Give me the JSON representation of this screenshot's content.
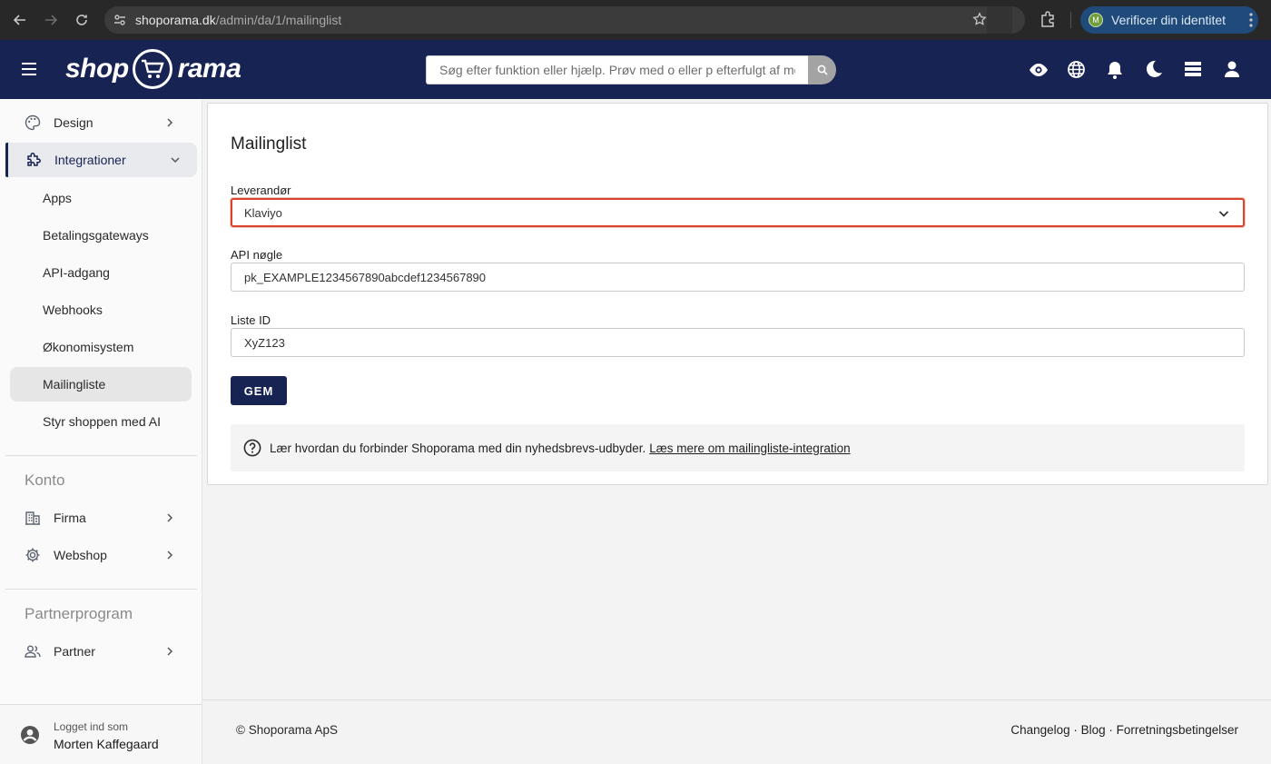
{
  "browser": {
    "url_host": "shoporama.dk",
    "url_path": "/admin/da/1/mailinglist",
    "profile_initial": "M",
    "profile_label": "Verificer din identitet"
  },
  "header": {
    "logo_left": "shop",
    "logo_right": "rama",
    "search_placeholder": "Søg efter funktion eller hjælp. Prøv med o eller p efterfulgt af me"
  },
  "sidebar": {
    "items": [
      {
        "label": "Design"
      },
      {
        "label": "Integrationer"
      }
    ],
    "sub_items": [
      {
        "label": "Apps"
      },
      {
        "label": "Betalingsgateways"
      },
      {
        "label": "API-adgang"
      },
      {
        "label": "Webhooks"
      },
      {
        "label": "Økonomisystem"
      },
      {
        "label": "Mailingliste"
      },
      {
        "label": "Styr shoppen med AI"
      }
    ],
    "konto": {
      "title": "Konto",
      "items": [
        {
          "label": "Firma"
        },
        {
          "label": "Webshop"
        }
      ]
    },
    "partner": {
      "title": "Partnerprogram",
      "items": [
        {
          "label": "Partner"
        }
      ]
    },
    "footer": {
      "logged_in_label": "Logget ind som",
      "user_name": "Morten Kaffegaard"
    }
  },
  "main": {
    "title": "Mailinglist",
    "provider_label": "Leverandør",
    "provider_value": "Klaviyo",
    "api_label": "API nøgle",
    "api_value": "pk_EXAMPLE1234567890abcdef1234567890",
    "list_label": "Liste ID",
    "list_value": "XyZ123",
    "save_label": "GEM",
    "info_text": "Lær hvordan du forbinder Shoporama med din nyhedsbrevs-udbyder.",
    "info_link": "Læs mere om mailingliste-integration"
  },
  "footer": {
    "copyright": "© Shoporama ApS",
    "links": "Changelog · Blog · Forretningsbetingelser"
  }
}
